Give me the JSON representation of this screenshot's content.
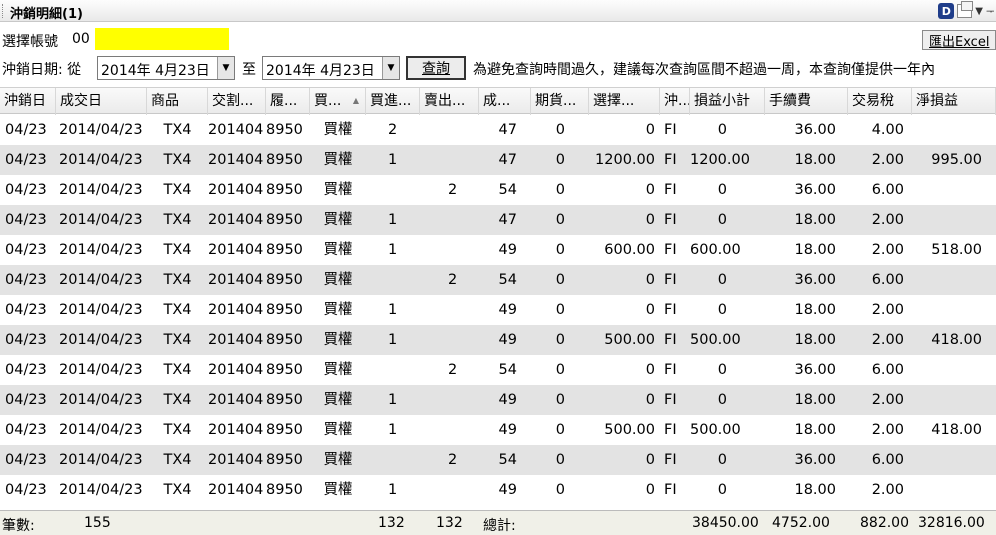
{
  "window": {
    "title": "沖銷明細(1)"
  },
  "account": {
    "label": "選擇帳號",
    "value": "00"
  },
  "export_label": "匯出Excel",
  "date_filter": {
    "label": "沖銷日期: 從",
    "from": "2014年  4月23日",
    "to_label": "至",
    "to": "2014年  4月23日",
    "query_label": "查詢",
    "notice": "為避免查詢時間過久，建議每次查詢區間不超過一周，本查詢僅提供一年內"
  },
  "columns": [
    "沖銷日",
    "成交日",
    "商品",
    "交割...",
    "履...",
    "買...",
    "買進...",
    "賣出...",
    "成...",
    "期貨...",
    "選擇...",
    "沖...",
    "損益小計",
    "手續費",
    "交易稅",
    "淨損益"
  ],
  "sort_indicator": "▲",
  "rows": [
    [
      "04/23",
      "2014/04/23",
      "TX4",
      "201404",
      "8950",
      "買權",
      "2",
      "",
      "47",
      "0",
      "0",
      "FI",
      "0",
      "36.00",
      "4.00",
      ""
    ],
    [
      "04/23",
      "2014/04/23",
      "TX4",
      "201404",
      "8950",
      "買權",
      "1",
      "",
      "47",
      "0",
      "1200.00",
      "FI",
      "1200.00",
      "18.00",
      "2.00",
      "995.00"
    ],
    [
      "04/23",
      "2014/04/23",
      "TX4",
      "201404",
      "8950",
      "買權",
      "",
      "2",
      "54",
      "0",
      "0",
      "FI",
      "0",
      "36.00",
      "6.00",
      ""
    ],
    [
      "04/23",
      "2014/04/23",
      "TX4",
      "201404",
      "8950",
      "買權",
      "1",
      "",
      "47",
      "0",
      "0",
      "FI",
      "0",
      "18.00",
      "2.00",
      ""
    ],
    [
      "04/23",
      "2014/04/23",
      "TX4",
      "201404",
      "8950",
      "買權",
      "1",
      "",
      "49",
      "0",
      "600.00",
      "FI",
      "600.00",
      "18.00",
      "2.00",
      "518.00"
    ],
    [
      "04/23",
      "2014/04/23",
      "TX4",
      "201404",
      "8950",
      "買權",
      "",
      "2",
      "54",
      "0",
      "0",
      "FI",
      "0",
      "36.00",
      "6.00",
      ""
    ],
    [
      "04/23",
      "2014/04/23",
      "TX4",
      "201404",
      "8950",
      "買權",
      "1",
      "",
      "49",
      "0",
      "0",
      "FI",
      "0",
      "18.00",
      "2.00",
      ""
    ],
    [
      "04/23",
      "2014/04/23",
      "TX4",
      "201404",
      "8950",
      "買權",
      "1",
      "",
      "49",
      "0",
      "500.00",
      "FI",
      "500.00",
      "18.00",
      "2.00",
      "418.00"
    ],
    [
      "04/23",
      "2014/04/23",
      "TX4",
      "201404",
      "8950",
      "買權",
      "",
      "2",
      "54",
      "0",
      "0",
      "FI",
      "0",
      "36.00",
      "6.00",
      ""
    ],
    [
      "04/23",
      "2014/04/23",
      "TX4",
      "201404",
      "8950",
      "買權",
      "1",
      "",
      "49",
      "0",
      "0",
      "FI",
      "0",
      "18.00",
      "2.00",
      ""
    ],
    [
      "04/23",
      "2014/04/23",
      "TX4",
      "201404",
      "8950",
      "買權",
      "1",
      "",
      "49",
      "0",
      "500.00",
      "FI",
      "500.00",
      "18.00",
      "2.00",
      "418.00"
    ],
    [
      "04/23",
      "2014/04/23",
      "TX4",
      "201404",
      "8950",
      "買權",
      "",
      "2",
      "54",
      "0",
      "0",
      "FI",
      "0",
      "36.00",
      "6.00",
      ""
    ],
    [
      "04/23",
      "2014/04/23",
      "TX4",
      "201404",
      "8950",
      "買權",
      "1",
      "",
      "49",
      "0",
      "0",
      "FI",
      "0",
      "18.00",
      "2.00",
      ""
    ]
  ],
  "footer": {
    "count_label": "筆數:",
    "count": "155",
    "buy_total": "132",
    "sell_total": "132",
    "total_label": "總計:",
    "pl_total": "38450.00",
    "fee_total": "4752.00",
    "tax_total": "882.00",
    "net_total": "32816.00"
  }
}
